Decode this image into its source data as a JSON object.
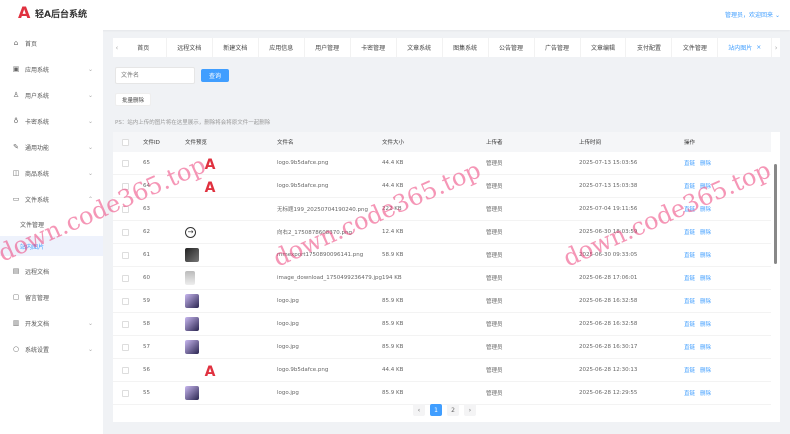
{
  "header": {
    "title": "轻A后台系统",
    "user": "管理员，欢迎回来"
  },
  "sidebar": {
    "items": [
      {
        "label": "首页",
        "icon": "home-icon",
        "glyph": "⌂",
        "chev": false
      },
      {
        "label": "应用系统",
        "icon": "app-icon",
        "glyph": "▣",
        "chev": true
      },
      {
        "label": "用户系统",
        "icon": "user-icon",
        "glyph": "♙",
        "chev": true
      },
      {
        "label": "卡密系统",
        "icon": "key-icon",
        "glyph": "♁",
        "chev": true
      },
      {
        "label": "通用功能",
        "icon": "edit-icon",
        "glyph": "✎",
        "chev": true
      },
      {
        "label": "商品系统",
        "icon": "bag-icon",
        "glyph": "◫",
        "chev": true
      },
      {
        "label": "文件系统",
        "icon": "folder-icon",
        "glyph": "▭",
        "chev": true,
        "open": true
      },
      {
        "label": "文件管理",
        "sub": true
      },
      {
        "label": "站内图片",
        "sub": true,
        "active": true
      },
      {
        "label": "远程文档",
        "icon": "doc-icon",
        "glyph": "▤",
        "chev": false
      },
      {
        "label": "留言管理",
        "icon": "message-icon",
        "glyph": "▢",
        "chev": false
      },
      {
        "label": "开发文档",
        "icon": "book-icon",
        "glyph": "▥",
        "chev": true
      },
      {
        "label": "系统设置",
        "icon": "settings-icon",
        "glyph": "○",
        "chev": true
      }
    ]
  },
  "tabs": [
    "首页",
    "远程文档",
    "新建文档",
    "应用信息",
    "用户管理",
    "卡密管理",
    "文章系统",
    "图集系统",
    "公告管理",
    "广告管理",
    "文章编辑",
    "支付配置",
    "文件管理",
    "站内图片"
  ],
  "toolbar": {
    "search_placeholder": "文件名",
    "query": "查询",
    "batch_delete": "批量删除",
    "ps": "PS：站内上传的图片将在这里展示，删除将会将原文件一起删除"
  },
  "table": {
    "headers": [
      "文件ID",
      "文件预览",
      "文件名",
      "文件大小",
      "上传者",
      "上传时间",
      "操作"
    ],
    "action_link": "直链",
    "action_delete": "删除",
    "rows": [
      {
        "id": "65",
        "preview": "logo",
        "name": "logo.9b5dafce.png",
        "size": "44.4 KB",
        "uploader": "管理员",
        "time": "2025-07-13 15:03:56"
      },
      {
        "id": "64",
        "preview": "logo",
        "name": "logo.9b5dafce.png",
        "size": "44.4 KB",
        "uploader": "管理员",
        "time": "2025-07-13 15:03:38"
      },
      {
        "id": "63",
        "preview": "none",
        "name": "无标题199_20250704190240.png",
        "size": "222 KB",
        "uploader": "管理员",
        "time": "2025-07-04 19:11:56"
      },
      {
        "id": "62",
        "preview": "arrow",
        "name": "向右2_1750878608370.png",
        "size": "12.4 KB",
        "uploader": "管理员",
        "time": "2025-06-30 18:03:59"
      },
      {
        "id": "61",
        "preview": "dark",
        "name": "mmexport1750890096141.png",
        "size": "58.9 KB",
        "uploader": "管理员",
        "time": "2025-06-30 09:33:05"
      },
      {
        "id": "60",
        "preview": "gray",
        "name": "image_download_1750499236479.jpg",
        "size": "194 KB",
        "uploader": "管理员",
        "time": "2025-06-28 17:06:01"
      },
      {
        "id": "59",
        "preview": "photo",
        "name": "logo.jpg",
        "size": "85.9 KB",
        "uploader": "管理员",
        "time": "2025-06-28 16:32:58"
      },
      {
        "id": "58",
        "preview": "photo",
        "name": "logo.jpg",
        "size": "85.9 KB",
        "uploader": "管理员",
        "time": "2025-06-28 16:32:58"
      },
      {
        "id": "57",
        "preview": "photo",
        "name": "logo.jpg",
        "size": "85.9 KB",
        "uploader": "管理员",
        "time": "2025-06-28 16:30:17"
      },
      {
        "id": "56",
        "preview": "logo",
        "name": "logo.9b5dafce.png",
        "size": "44.4 KB",
        "uploader": "管理员",
        "time": "2025-06-28 12:30:13"
      },
      {
        "id": "55",
        "preview": "photo",
        "name": "logo.jpg",
        "size": "85.9 KB",
        "uploader": "管理员",
        "time": "2025-06-28 12:29:55"
      }
    ]
  },
  "pagination": {
    "pages": [
      "1",
      "2"
    ],
    "current": "1"
  },
  "watermark": "down.code365.top"
}
